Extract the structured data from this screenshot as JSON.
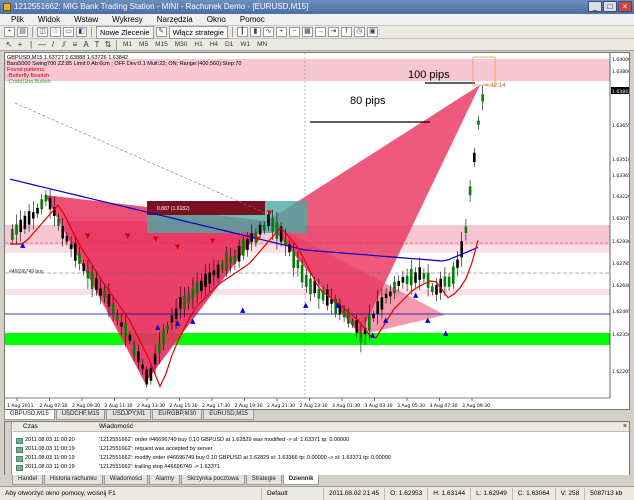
{
  "window": {
    "title": "1212551662: MIG Bank Trading Station - MINI - Rachunek Demo - [EURUSD,M15]",
    "minimize": "_",
    "maximize": "□",
    "close": "×"
  },
  "menu": [
    "Plik",
    "Widok",
    "Wstaw",
    "Wykresy",
    "Narzędzia",
    "Okno",
    "Pomoc"
  ],
  "toolbar": {
    "new_order": "Nowe Zlecenie",
    "expert": "Włącz strategie"
  },
  "timeframes": [
    "M1",
    "M5",
    "M15",
    "M30",
    "H1",
    "H4",
    "D1",
    "W1",
    "MN"
  ],
  "chart": {
    "info_symbol": "GBPUSD,M15  1.63727 1.63888 1.63726 1.63842",
    "info_indicator": "Bars5000 Swing700 ZZ:85 Limit:0 Ab:6cm ; OFF Dev:0.1 Mult:22; ON; Range:(400,560):Step:70",
    "found_patterns": "Found patterns:",
    "pattern_1": "-Butterfly Bearish",
    "pattern_2": "-Crab(Gha Bullish",
    "label_100": "100 pips",
    "label_80": "80 pips",
    "countdown": "<-12:14",
    "box_label": "0.887 (1.6182)",
    "order_label": "#46696749 buy",
    "price_labels": [
      {
        "text": "1.64000"
      },
      {
        "text": "1.63800"
      },
      {
        "text": "1.63842"
      },
      {
        "text": "1.63655"
      },
      {
        "text": "1.63510"
      },
      {
        "text": "1.63365"
      },
      {
        "text": "1.63220"
      },
      {
        "text": "1.63075"
      },
      {
        "text": "1.62930"
      },
      {
        "text": "1.62785"
      },
      {
        "text": "1.62640"
      },
      {
        "text": "1.62495"
      },
      {
        "text": "1.62350"
      },
      {
        "text": "1.62205"
      }
    ],
    "time_labels": [
      "1 Aug 2011",
      "2 Aug 07:30",
      "2 Aug 09:30",
      "2 Aug 11:30",
      "2 Aug 13:30",
      "2 Aug 15:30",
      "2 Aug 17:30",
      "2 Aug 19:30",
      "2 Aug 21:30",
      "2 Aug 23:30",
      "3 Aug 01:30",
      "3 Aug 03:30",
      "3 Aug 05:30",
      "3 Aug 07:30",
      "3 Aug 09:30"
    ]
  },
  "symbol_tabs": [
    "GBPUSD,M15",
    "USDCHF,M15",
    "USDJPY,M1",
    "EURGBP,M30",
    "EURUSD,M15"
  ],
  "terminal": {
    "col_time": "Czas",
    "col_msg": "Wiadomość",
    "rows": [
      {
        "time": "2011.08.03 11:00:20",
        "msg": "'1212551662': order #46696749 buy 0.10 GBPUSD at 1.62829 was modified -> sl: 1.63371 tp: 0.00000"
      },
      {
        "time": "2011.08.03 11:00:19",
        "msg": "'1212551662': request was accepted by server"
      },
      {
        "time": "2011.08.03 11:00:19",
        "msg": "'1212551662': modify order #46696749 buy 0.10 GBPUSD at 1.62829 sl: 1.63366 tp: 0.00000 -> sl: 1.63371 tp: 0.00000"
      },
      {
        "time": "2011.08.03 11:00:19",
        "msg": "'1212551662': trailing stop #46696749 -> 1.63371"
      }
    ],
    "tabs": [
      "Handel",
      "Historia rachunku",
      "Wiadomości",
      "Alarmy",
      "Skrzynka pocztowa",
      "Strategie",
      "Dziennik"
    ],
    "active_tab": "Dziennik"
  },
  "status": {
    "help": "Aby otworzyć okno pomocy, wciśnij F1",
    "profile": "Default",
    "datetime": "2011.08.02 21:45",
    "open": "O: 1.62953",
    "high": "H: 1.63144",
    "low": "L: 1.62949",
    "close": "C: 1.63064",
    "volume": "V: 258",
    "traffic": "5087/13 kb"
  },
  "colors": {
    "bull_candle": "#008000",
    "bear_candle": "#000000",
    "pattern_fill": "#e8315e",
    "zone_green": "#00ff00",
    "zone_pink": "#f7c6d3",
    "ma_blue": "#0000cc",
    "ma_red": "#e00000"
  }
}
